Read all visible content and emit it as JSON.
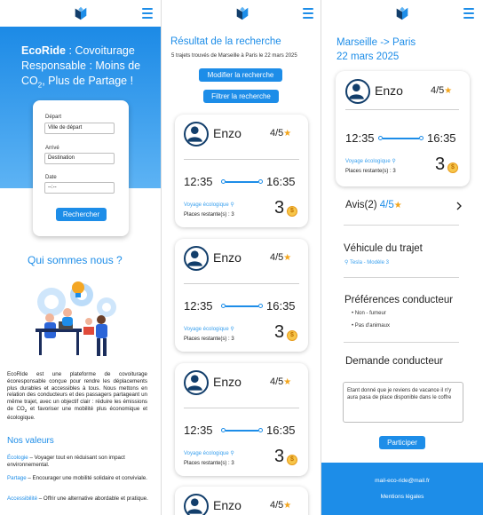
{
  "brand": {
    "accent": "#1d8de8",
    "dark": "#123e6b",
    "star": "#f3a51c"
  },
  "home": {
    "hero": {
      "brand": "EcoRide",
      "colon": " : ",
      "title_a": "Covoiturage Responsable : Moins de CO",
      "title_sub": "2",
      "title_b": ", Plus de Partage !"
    },
    "search": {
      "depart_label": "Départ",
      "depart_placeholder": "Ville de départ",
      "arrive_label": "Arrivé",
      "arrive_placeholder": "Destination",
      "date_label": "Date",
      "date_value": "--:--",
      "button": "Rechercher"
    },
    "about_title": "Qui sommes nous ?",
    "about_text_a": "EcoRide est une plateforme de covoiturage écoresponsable conçue pour rendre les déplacements plus durables et accessibles à tous. Nous mettons en relation des conducteurs et des passagers partageant un même trajet, avec un objectif clair : réduire les émissions de CO",
    "about_text_sub": "2",
    "about_text_b": " et favoriser une mobilité plus économique et écologique.",
    "values_title": "Nos valeurs",
    "values": [
      {
        "key": "Écologie",
        "text": " – Voyager tout en réduisant son impact environnemental."
      },
      {
        "key": "Partage",
        "text": " – Encourager une mobilité solidaire et conviviale."
      },
      {
        "key": "Accessibilité",
        "text": " – Offrir une alternative abordable et pratique."
      }
    ]
  },
  "results": {
    "title": "Résultat de la recherche",
    "subtitle": "5 trajets trouvés de Marseille à Paris le 22 mars 2025",
    "modify_button": "Modifier la recherche",
    "filter_button": "Filtrer la recherche",
    "trips": [
      {
        "driver": "Enzo",
        "rating": "4/5",
        "depart": "12:35",
        "arrive": "16:35",
        "eco": "Voyage écologique",
        "places": "Places restante(s) : 3",
        "price": "3"
      },
      {
        "driver": "Enzo",
        "rating": "4/5",
        "depart": "12:35",
        "arrive": "16:35",
        "eco": "Voyage écologique",
        "places": "Places restante(s) : 3",
        "price": "3"
      },
      {
        "driver": "Enzo",
        "rating": "4/5",
        "depart": "12:35",
        "arrive": "16:35",
        "eco": "Voyage écologique",
        "places": "Places restante(s) : 3",
        "price": "3"
      },
      {
        "driver": "Enzo",
        "rating": "4/5"
      }
    ]
  },
  "detail": {
    "route": "Marseille -> Paris",
    "date": "22 mars 2025",
    "trip": {
      "driver": "Enzo",
      "rating": "4/5",
      "depart": "12:35",
      "arrive": "16:35",
      "eco": "Voyage écologique",
      "places": "Places restante(s) : 3",
      "price": "3"
    },
    "reviews_label": "Avis(2)",
    "reviews_rating": "4/5",
    "vehicle_title": "Véhicule du trajet",
    "vehicle_model": "Tesla - Modèle 3",
    "prefs_title": "Préférences conducteur",
    "prefs": [
      "Non - fumeur",
      "Pas d'animaux"
    ],
    "request_title": "Demande conducteur",
    "request_text": "Etant donné que je reviens de vacance il n'y aura pasa de place disponible dans le coffre",
    "participate_button": "Participer",
    "footer_email": "mail-eco-ride@mail.fr",
    "footer_legal": "Mentions légales"
  },
  "icons": {
    "logo": "leaf-logo-icon",
    "menu": "hamburger-menu-icon",
    "avatar": "user-avatar-icon",
    "star": "star-icon",
    "leaf": "eco-leaf-icon",
    "coin": "credit-coin-icon",
    "chevron": "chevron-right-icon",
    "car": "car-icon"
  }
}
